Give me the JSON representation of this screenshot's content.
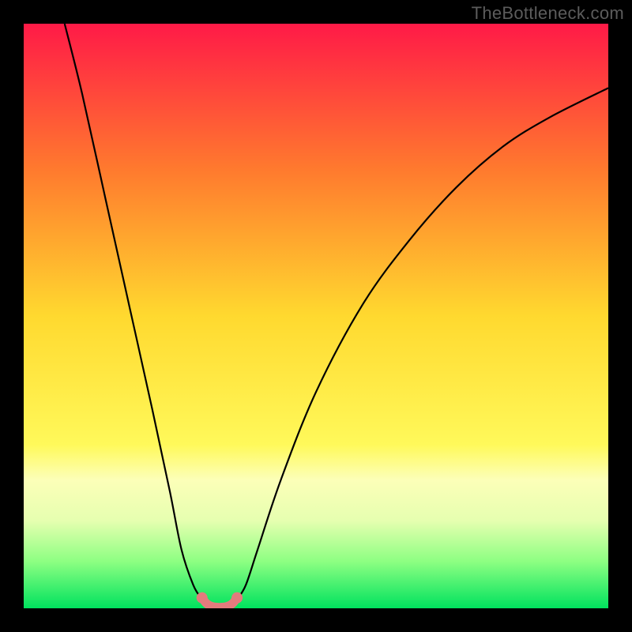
{
  "watermark": "TheBottleneck.com",
  "chart_data": {
    "type": "line",
    "title": "",
    "xlabel": "",
    "ylabel": "",
    "xlim": [
      0,
      100
    ],
    "ylim": [
      0,
      100
    ],
    "series": [
      {
        "name": "curve-left",
        "points": [
          {
            "x": 7,
            "y": 100
          },
          {
            "x": 10,
            "y": 88
          },
          {
            "x": 14,
            "y": 70
          },
          {
            "x": 18,
            "y": 52
          },
          {
            "x": 22,
            "y": 34
          },
          {
            "x": 25,
            "y": 20
          },
          {
            "x": 27,
            "y": 10
          },
          {
            "x": 29,
            "y": 4
          },
          {
            "x": 30.5,
            "y": 1.5
          }
        ]
      },
      {
        "name": "curve-right",
        "points": [
          {
            "x": 36.5,
            "y": 1.5
          },
          {
            "x": 38,
            "y": 4
          },
          {
            "x": 40,
            "y": 10
          },
          {
            "x": 44,
            "y": 22
          },
          {
            "x": 50,
            "y": 37
          },
          {
            "x": 58,
            "y": 52
          },
          {
            "x": 66,
            "y": 63
          },
          {
            "x": 74,
            "y": 72
          },
          {
            "x": 82,
            "y": 79
          },
          {
            "x": 90,
            "y": 84
          },
          {
            "x": 100,
            "y": 89
          }
        ]
      },
      {
        "name": "valley-highlight",
        "color": "#e37b7d",
        "points": [
          {
            "x": 30.5,
            "y": 1.8
          },
          {
            "x": 31.2,
            "y": 0.9
          },
          {
            "x": 32.0,
            "y": 0.4
          },
          {
            "x": 33.0,
            "y": 0.2
          },
          {
            "x": 34.0,
            "y": 0.2
          },
          {
            "x": 35.0,
            "y": 0.4
          },
          {
            "x": 35.8,
            "y": 0.9
          },
          {
            "x": 36.5,
            "y": 1.8
          }
        ]
      }
    ],
    "background": {
      "type": "vertical-gradient",
      "stops": [
        {
          "pct": 0,
          "color": "#ff1a47"
        },
        {
          "pct": 25,
          "color": "#ff7a2e"
        },
        {
          "pct": 50,
          "color": "#ffd92f"
        },
        {
          "pct": 72,
          "color": "#fff95a"
        },
        {
          "pct": 78,
          "color": "#fcffb8"
        },
        {
          "pct": 85,
          "color": "#e6ffb0"
        },
        {
          "pct": 92,
          "color": "#8dff82"
        },
        {
          "pct": 100,
          "color": "#00e25e"
        }
      ]
    }
  }
}
